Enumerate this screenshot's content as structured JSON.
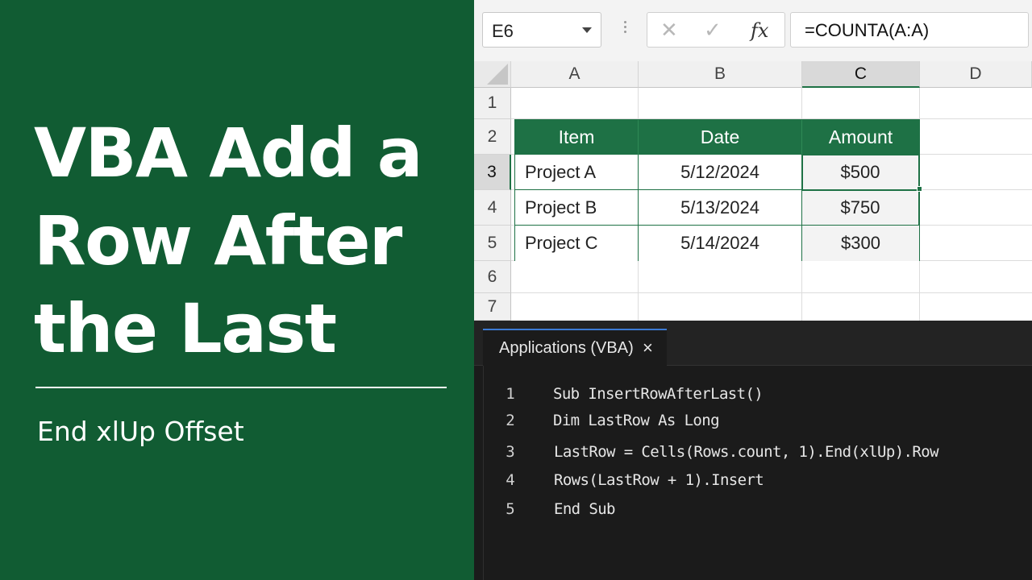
{
  "title_panel": {
    "title_lines": [
      "VBA Add a",
      "Row After",
      "the Last"
    ],
    "subtitle": "End xlUp Offset",
    "background": "#115c33"
  },
  "formula_bar": {
    "name_box": "E6",
    "cancel_icon": "x-icon",
    "enter_icon": "checkmark-icon",
    "fx_label": "fx",
    "formula": "=COUNTA(A:A)"
  },
  "sheet": {
    "columns": [
      "A",
      "B",
      "C",
      "D"
    ],
    "active_column": "C",
    "rows": [
      "1",
      "2",
      "3",
      "4",
      "5",
      "6",
      "7"
    ],
    "active_row": "3",
    "table": {
      "headers": [
        "Item",
        "Date",
        "Amount"
      ],
      "rows": [
        [
          "Project A",
          "5/12/2024",
          "$500"
        ],
        [
          "Project B",
          "5/13/2024",
          "$750"
        ],
        [
          "Project C",
          "5/14/2024",
          "$300"
        ]
      ]
    },
    "accent_color": "#1e7145"
  },
  "vba_editor": {
    "tab_label": "Applications (VBA)",
    "tab_close": "×",
    "lines": [
      {
        "no": "1",
        "code": "Sub InsertRowAfterLast()"
      },
      {
        "no": "2",
        "code": "Dim LastRow As Long"
      },
      {
        "no": "3",
        "code": "LastRow = Cells(Rows.count, 1).End(xlUp).Row"
      },
      {
        "no": "4",
        "code": "Rows(LastRow + 1).Insert"
      },
      {
        "no": "5",
        "code": "End Sub"
      }
    ]
  }
}
